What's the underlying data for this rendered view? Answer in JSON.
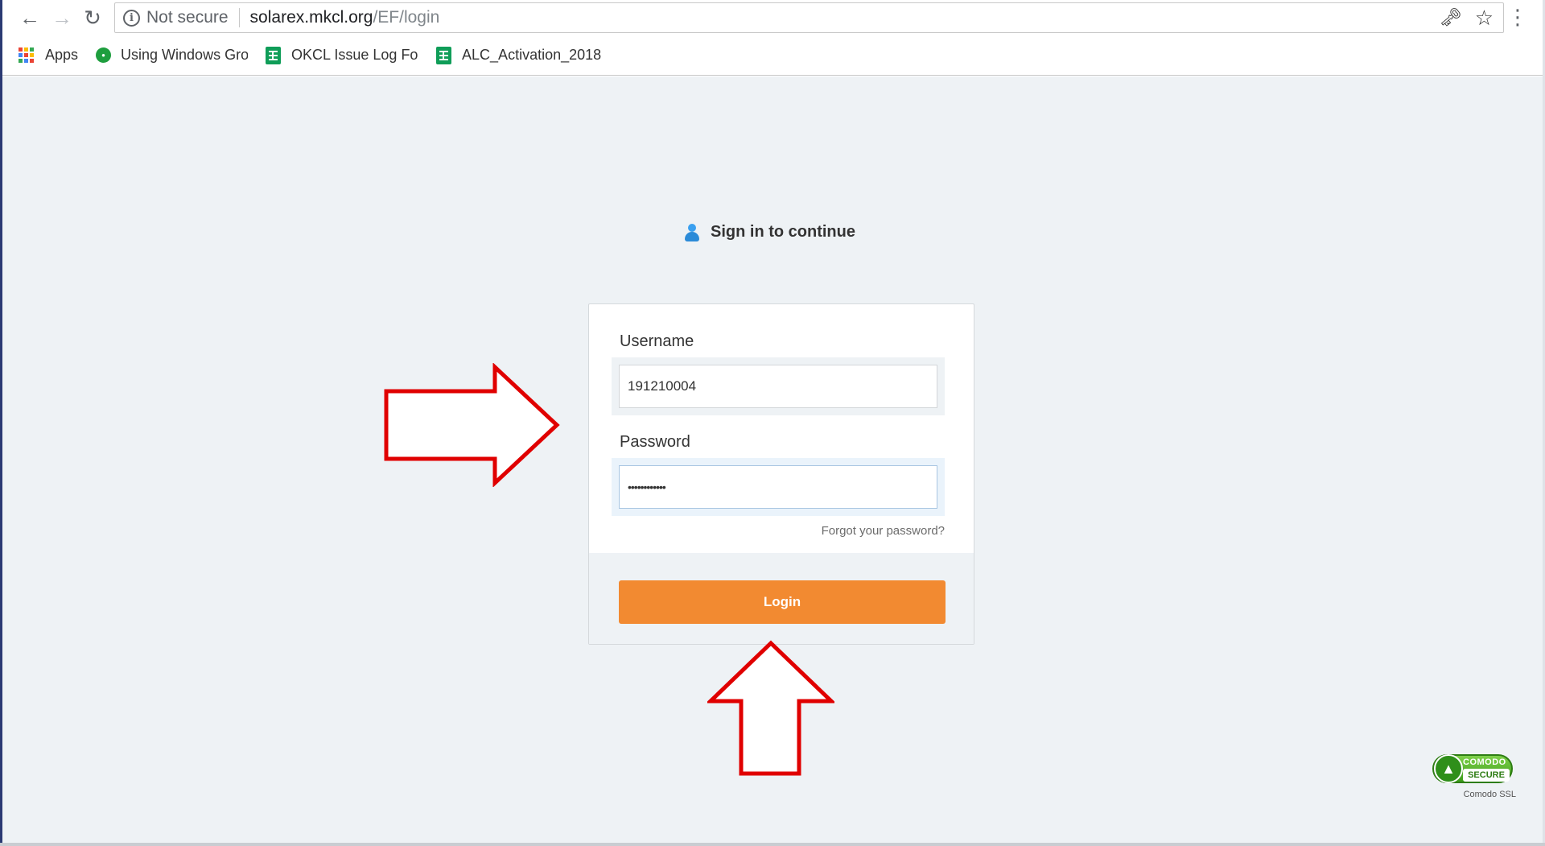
{
  "browser": {
    "url_security": "Not secure",
    "url_host": "solarex.mkcl.org",
    "url_path": "/EF/login",
    "icons": {
      "back": "arrow-left-icon",
      "forward": "arrow-right-icon",
      "reload": "reload-icon",
      "info": "info-icon",
      "key": "key-icon",
      "star": "star-icon",
      "menu": "vertical-dots-icon"
    }
  },
  "bookmarks": [
    {
      "label": "Apps",
      "icon": "apps-grid-icon"
    },
    {
      "label": "Using Windows Grou",
      "icon": "green-circle-icon"
    },
    {
      "label": "OKCL Issue Log Form",
      "icon": "spreadsheet-icon"
    },
    {
      "label": "ALC_Activation_2018",
      "icon": "spreadsheet-icon"
    }
  ],
  "login": {
    "heading": "Sign in to continue",
    "username_label": "Username",
    "username_value": "191210004",
    "password_label": "Password",
    "password_value": "••••••••••••",
    "forgot_link": "Forgot your password?",
    "login_button": "Login"
  },
  "badge": {
    "line1": "COMODO",
    "line2": "SECURE",
    "caption": "Comodo SSL"
  },
  "colors": {
    "accent": "#f28a31",
    "page_background": "#eef2f5",
    "arrow_outline": "#e00000",
    "badge_green": "#3a9b1a"
  }
}
